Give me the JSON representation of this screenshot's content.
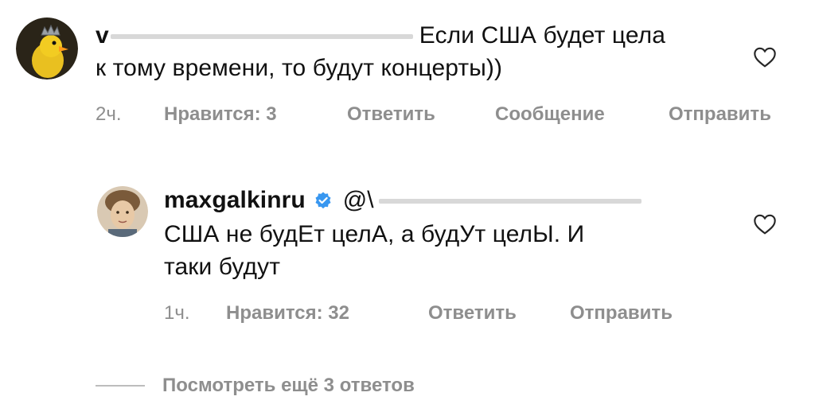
{
  "comments": [
    {
      "username_fragment": "v",
      "text_line1": "Если США будет цела",
      "text_line2": "к тому времени, то будут концерты))",
      "time": "2ч.",
      "likes": "Нравится: 3",
      "reply": "Ответить",
      "message": "Сообщение",
      "send": "Отправить",
      "like_icon": "heart-outline-icon"
    }
  ],
  "reply": {
    "username": "maxgalkinru",
    "mention_prefix": "@\\",
    "verified_icon": "verified-badge-icon",
    "text_line1": "США не будЕт целА, а будУт целЫ. И",
    "text_line2": "таки будут",
    "time": "1ч.",
    "likes": "Нравится: 32",
    "reply": "Ответить",
    "send": "Отправить",
    "like_icon": "heart-outline-icon"
  },
  "view_more": "Посмотреть ещё 3 ответов",
  "colors": {
    "text": "#111111",
    "meta": "#8e8e8e",
    "verified": "#3897f0",
    "background": "#ffffff"
  }
}
